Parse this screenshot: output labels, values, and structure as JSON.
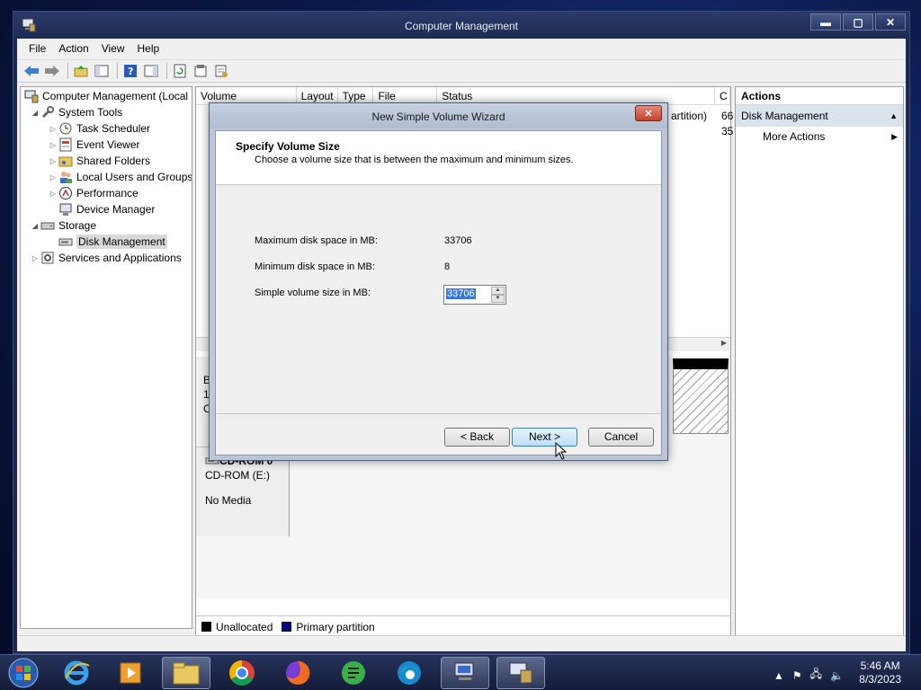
{
  "window": {
    "title": "Computer Management",
    "buttons": {
      "minimize": "▬",
      "maximize": "▢",
      "close": "✕"
    }
  },
  "menu": [
    "File",
    "Action",
    "View",
    "Help"
  ],
  "tree": {
    "root": "Computer Management (Local",
    "system_tools": "System Tools",
    "task_scheduler": "Task Scheduler",
    "event_viewer": "Event Viewer",
    "shared_folders": "Shared Folders",
    "local_users": "Local Users and Groups",
    "performance": "Performance",
    "device_manager": "Device Manager",
    "storage": "Storage",
    "disk_management": "Disk Management",
    "services": "Services and Applications"
  },
  "columns": [
    "Volume",
    "Layout",
    "Type",
    "File System",
    "Status",
    "C"
  ],
  "volume_snippets": {
    "row1_tail": "artition)",
    "row1_cap": "66",
    "row2_cap": "35"
  },
  "disk_area": {
    "cdrom_name": "CD-ROM 0",
    "cdrom_drive": "CD-ROM (E:)",
    "cdrom_media": "No Media",
    "disk0_line1": "B",
    "disk0_line2": "1",
    "disk0_line3": "C"
  },
  "legend": {
    "unallocated": "Unallocated",
    "primary": "Primary partition"
  },
  "actions": {
    "header": "Actions",
    "section": "Disk Management",
    "more": "More Actions"
  },
  "wizard": {
    "title": "New Simple Volume Wizard",
    "close": "✕",
    "heading": "Specify Volume Size",
    "subheading": "Choose a volume size that is between the maximum and minimum sizes.",
    "max_label": "Maximum disk space in MB:",
    "max_value": "33706",
    "min_label": "Minimum disk space in MB:",
    "min_value": "8",
    "size_label": "Simple volume size in MB:",
    "size_value": "33706",
    "back": "< Back",
    "next": "Next >",
    "cancel": "Cancel"
  },
  "taskbar": {
    "clock_time": "5:46 AM",
    "clock_date": "8/3/2023"
  },
  "colors": {
    "accent": "#3a78d8",
    "unallocated": "#000000",
    "primary_partition": "#00007f"
  }
}
